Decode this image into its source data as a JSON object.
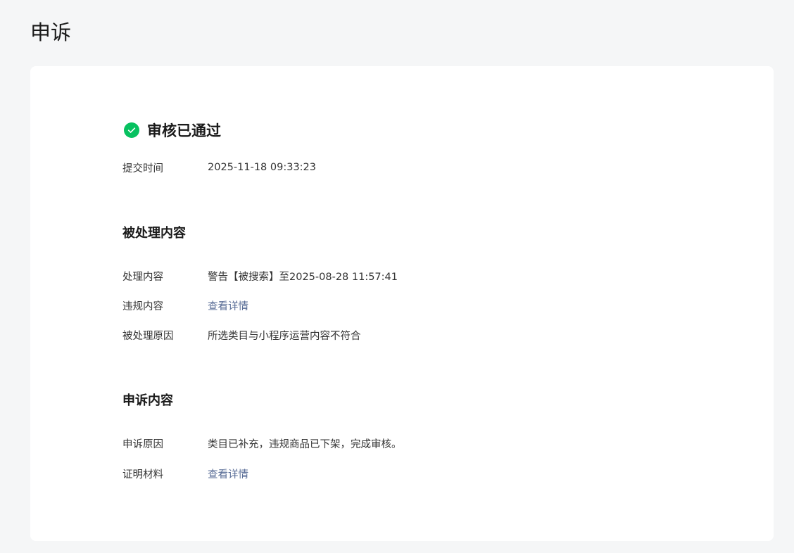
{
  "page": {
    "title": "申诉"
  },
  "status": {
    "text": "审核已通过",
    "icon": "check-circle-icon",
    "color": "#07c160"
  },
  "submit": {
    "label": "提交时间",
    "value": "2025-11-18 09:33:23"
  },
  "processed": {
    "title": "被处理内容",
    "rows": [
      {
        "label": "处理内容",
        "value": "警告【被搜索】至2025-08-28 11:57:41"
      },
      {
        "label": "违规内容",
        "value": "查看详情"
      },
      {
        "label": "被处理原因",
        "value": "所选类目与小程序运营内容不符合"
      }
    ]
  },
  "appeal": {
    "title": "申诉内容",
    "rows": [
      {
        "label": "申诉原因",
        "value": "类目已补充，违规商品已下架，完成审核。"
      },
      {
        "label": "证明材料",
        "value": "查看详情"
      }
    ]
  },
  "colors": {
    "link": "#576b95",
    "background": "#f5f6f7"
  }
}
